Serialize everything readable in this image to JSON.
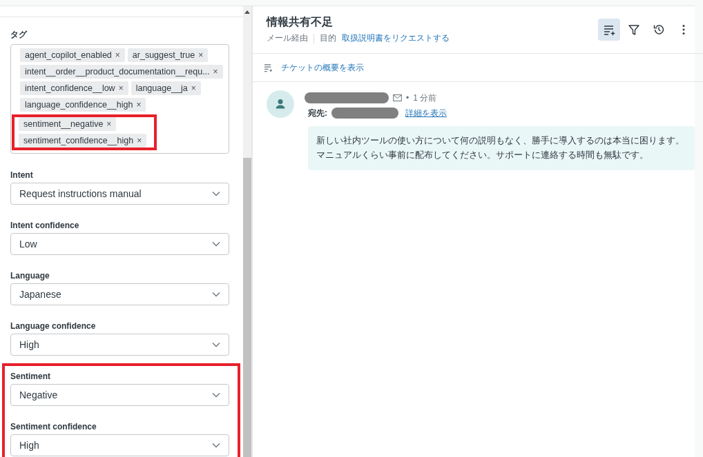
{
  "tags_field": {
    "label": "タグ",
    "tags": [
      {
        "text": "agent_copilot_enabled",
        "remove": "×",
        "highlighted": false
      },
      {
        "text": "ar_suggest_true",
        "remove": "×",
        "highlighted": false
      },
      {
        "text": "intent__order__product_documentation__requ...",
        "remove": "×",
        "highlighted": false
      },
      {
        "text": "intent_confidence__low",
        "remove": "×",
        "highlighted": false
      },
      {
        "text": "language__ja",
        "remove": "×",
        "highlighted": false
      },
      {
        "text": "language_confidence__high",
        "remove": "×",
        "highlighted": false
      },
      {
        "text": "sentiment__negative",
        "remove": "×",
        "highlighted": true
      },
      {
        "text": "sentiment_confidence__high",
        "remove": "×",
        "highlighted": true
      }
    ]
  },
  "fields": [
    {
      "label": "Intent",
      "value": "Request instructions manual",
      "highlighted": false
    },
    {
      "label": "Intent confidence",
      "value": "Low",
      "highlighted": false
    },
    {
      "label": "Language",
      "value": "Japanese",
      "highlighted": false
    },
    {
      "label": "Language confidence",
      "value": "High",
      "highlighted": false
    },
    {
      "label": "Sentiment",
      "value": "Negative",
      "highlighted": true
    },
    {
      "label": "Sentiment confidence",
      "value": "High",
      "highlighted": true
    }
  ],
  "ticket": {
    "title": "情報共有不足",
    "channel": "メール経由",
    "intent_label": "目的",
    "intent_link": "取扱説明書をリクエストする",
    "toolbar": [
      {
        "kind": "summary",
        "selected": true
      },
      {
        "kind": "filter",
        "selected": false
      },
      {
        "kind": "history",
        "selected": false
      },
      {
        "kind": "more",
        "selected": false
      }
    ],
    "summary_link": "チケットの概要を表示"
  },
  "message": {
    "separator": "•",
    "time": "1 分前",
    "to_label": "宛先:",
    "details_link": "詳細を表示",
    "body": "新しい社内ツールの使い方について何の説明もなく、勝手に導入するのは本当に困ります。マニュアルくらい事前に配布してください。サポートに連絡する時間も無駄です。"
  }
}
